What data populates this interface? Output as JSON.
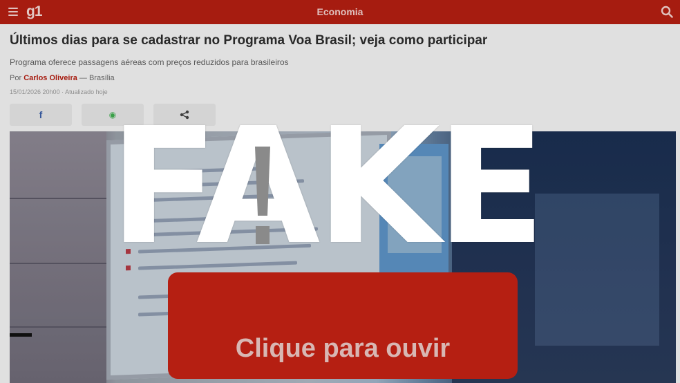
{
  "topbar": {
    "logo": "g1",
    "section": "Economia"
  },
  "article": {
    "headline": "Últimos dias para se cadastrar no Programa Voa Brasil; veja como participar",
    "subheadline": "Programa oferece passagens aéreas com preços reduzidos para brasileiros",
    "byline_prefix": "Por",
    "author": "Carlos Oliveira",
    "location": "— Brasília",
    "dateline": "15/01/2026 20h00 · Atualizado hoje"
  },
  "share": {
    "facebook": "f",
    "whatsapp": "◉",
    "share": "<"
  },
  "overlay": {
    "stamp": "FAKE",
    "listen_button": "Clique para ouvir"
  },
  "colors": {
    "brand": "#b51f12",
    "stamp": "#ffffff"
  },
  "icons": [
    "menu-icon",
    "search-icon",
    "facebook-icon",
    "whatsapp-icon",
    "share-icon",
    "warning-icon"
  ]
}
